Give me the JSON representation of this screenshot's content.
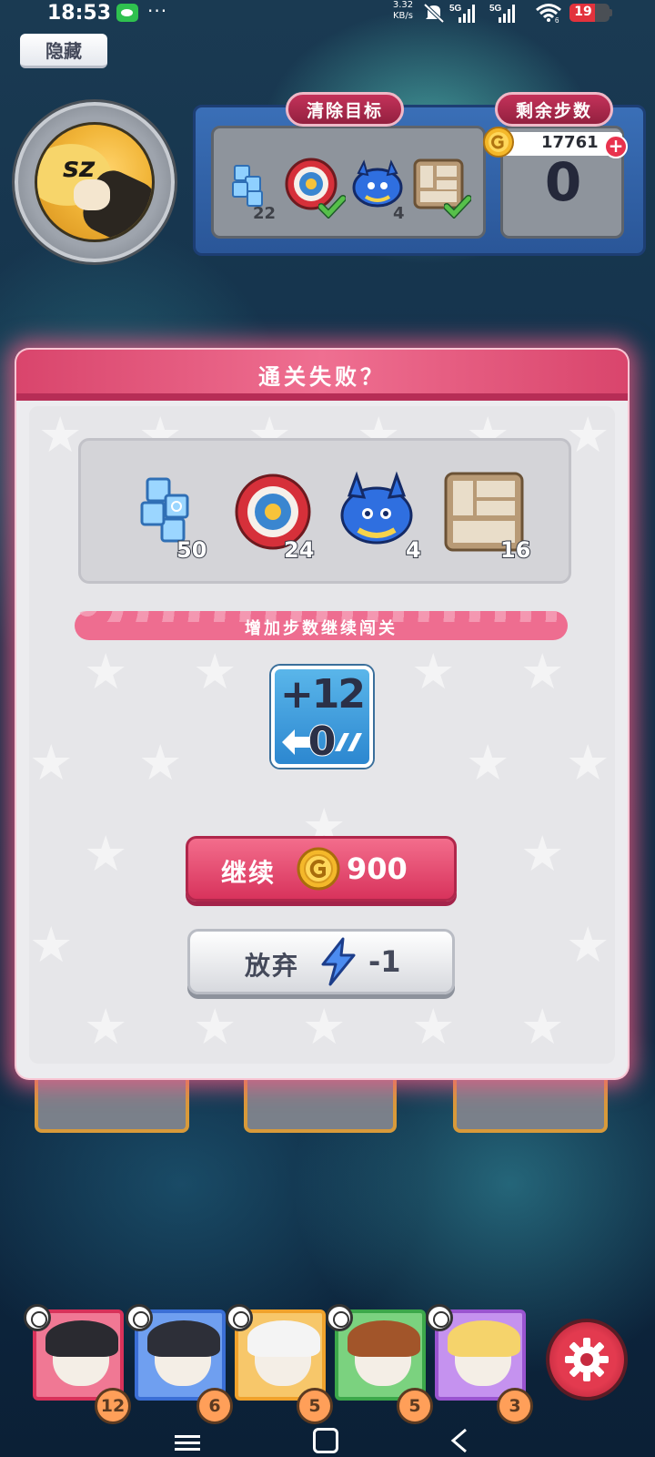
{
  "status_bar": {
    "time": "18:53",
    "more": "···",
    "net_speed_value": "3.32",
    "net_speed_unit": "KB/s",
    "signal_1_label": "5G",
    "signal_2_label": "5G",
    "wifi_sub": "6",
    "battery_level": "19",
    "icons": [
      "wechat-icon",
      "mute-icon",
      "signal-5g-icon",
      "wifi-icon",
      "battery-icon"
    ]
  },
  "hide_button": {
    "label": "隐藏"
  },
  "top_panel": {
    "goals_title": "清除目标",
    "steps_title": "剩余步数",
    "coins": "17761",
    "plus": "+",
    "steps_left": "0",
    "goals": [
      {
        "icon": "ice-block-icon",
        "count": "22",
        "done": false
      },
      {
        "icon": "target-icon",
        "count": "",
        "done": true
      },
      {
        "icon": "blue-crab-icon",
        "count": "4",
        "done": false
      },
      {
        "icon": "stone-wall-icon",
        "count": "",
        "done": true
      }
    ]
  },
  "modal": {
    "title": "通关失败？",
    "goals": [
      {
        "icon": "ice-block-icon",
        "count": "50"
      },
      {
        "icon": "target-icon",
        "count": "24"
      },
      {
        "icon": "blue-crab-icon",
        "count": "4"
      },
      {
        "icon": "stone-wall-icon",
        "count": "16"
      }
    ],
    "banner": "增加步数继续闯关",
    "bonus_top": "+12",
    "bonus_bottom": "0",
    "continue_label": "继续",
    "continue_cost": "900",
    "giveup_label": "放弃",
    "giveup_cost": "-1"
  },
  "characters": [
    {
      "count": "12",
      "color": "#d8325a",
      "hair": "#2a2a30"
    },
    {
      "count": "6",
      "color": "#3b6fd6",
      "hair": "#2d2f38"
    },
    {
      "count": "5",
      "color": "#f0a22c",
      "hair": "#f4f4f4"
    },
    {
      "count": "5",
      "color": "#3ca84a",
      "hair": "#a2552a"
    },
    {
      "count": "3",
      "color": "#9a54d0",
      "hair": "#f5d36b"
    }
  ],
  "colors": {
    "accent_pink": "#e8466f",
    "panel_blue": "#2f60a6",
    "continue_button": "#e8466f",
    "giveup_button": "#f0f0f2"
  }
}
